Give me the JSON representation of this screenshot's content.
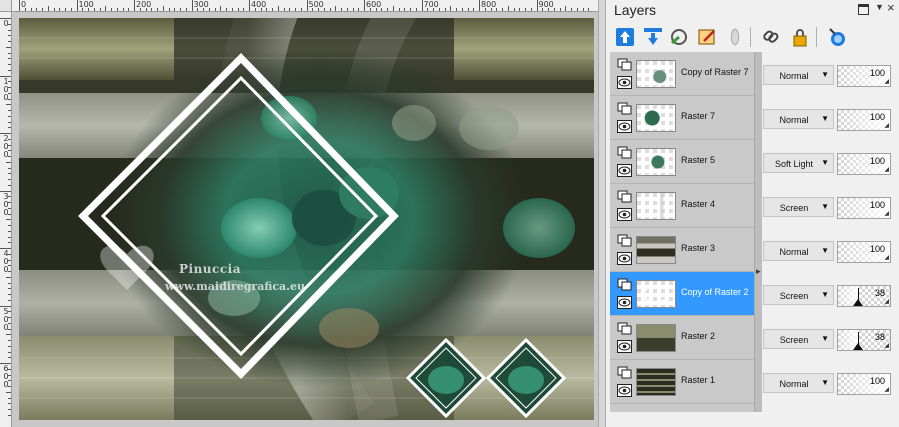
{
  "ruler": {
    "top_labels": [
      "0",
      "100",
      "200",
      "300",
      "400",
      "500",
      "600",
      "700",
      "800",
      "900"
    ],
    "left_labels": [
      "0",
      "1\n0\n0",
      "2\n0\n0",
      "3\n0\n0",
      "4\n0\n0",
      "5\n0\n0",
      "6\n0\n0"
    ]
  },
  "canvas": {
    "watermark_name": "Pinuccia",
    "watermark_url": "www.maidiregrafica.eu"
  },
  "layers_panel": {
    "title": "Layers",
    "toolbar_icons": [
      "move-layer-up-icon",
      "move-layer-down-icon",
      "new-raster-layer-icon",
      "edit-selection-icon",
      "mask-icon",
      "link-icon",
      "lock-icon",
      "properties-icon"
    ],
    "layers": [
      {
        "name": "Copy of Raster 7",
        "blend": "Normal",
        "opacity": "100",
        "selected": false
      },
      {
        "name": "Raster 7",
        "blend": "Normal",
        "opacity": "100",
        "selected": false
      },
      {
        "name": "Raster 5",
        "blend": "Soft Light",
        "opacity": "100",
        "selected": false
      },
      {
        "name": "Raster 4",
        "blend": "Screen",
        "opacity": "100",
        "selected": false
      },
      {
        "name": "Raster 3",
        "blend": "Normal",
        "opacity": "100",
        "selected": false
      },
      {
        "name": "Copy of Raster 2",
        "blend": "Screen",
        "opacity": "38",
        "selected": true
      },
      {
        "name": "Raster 2",
        "blend": "Screen",
        "opacity": "38",
        "selected": false
      },
      {
        "name": "Raster 1",
        "blend": "Normal",
        "opacity": "100",
        "selected": false
      }
    ]
  },
  "colors": {
    "selection": "#3399ff",
    "panel_bg": "#f0f0f0",
    "list_bg": "#c9c9c9"
  }
}
